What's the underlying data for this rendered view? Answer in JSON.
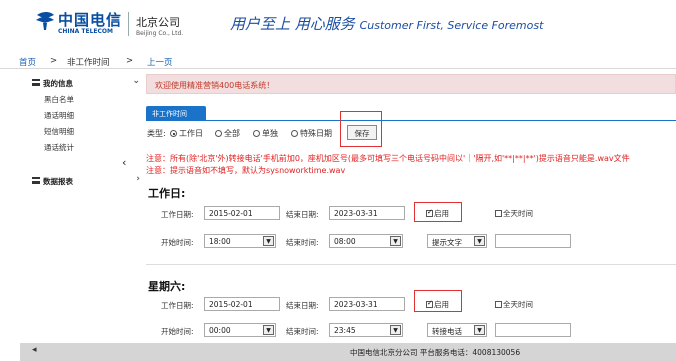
{
  "header": {
    "logo_cn": "中国电信",
    "logo_en": "CHINA TELECOM",
    "branch_cn": "北京公司",
    "branch_en": "Beijing Co., Ltd.",
    "slogan_cn": "用户至上 用心服务",
    "slogan_en": "Customer First, Service Foremost"
  },
  "breadcrumb": {
    "home": "首页",
    "sep1": ">",
    "current": "非工作时间",
    "sep2": ">",
    "prev": "上一页"
  },
  "sidebar": {
    "group1": "我的信息",
    "items": [
      "黑白名单",
      "通话明细",
      "短信明细",
      "通话统计"
    ],
    "group2": "数据报表",
    "collapse_glyph": "‹"
  },
  "notice": "欢迎使用精准营销400电话系统！",
  "tab": "非工作时间",
  "type_row": {
    "label": "类型:",
    "options": [
      "工作日",
      "全部",
      "单独",
      "特殊日期"
    ],
    "selected": "工作日",
    "save": "保存"
  },
  "warnings": {
    "line1": "注意：所有(除'北京'外)转接电话'手机前加0，座机加区号(最多可填写三个电话号码中间以'｜'隔开,如'**|**|**')提示语音只能是.wav文件",
    "line2": "注意：提示语音如不填写，默认为sysnoworktime.wav"
  },
  "workday": {
    "title": "工作日:",
    "work_date_label": "工作日期:",
    "work_date": "2015-02-01",
    "end_date_label": "结束日期:",
    "end_date": "2023-03-31",
    "enable_label": "启用",
    "enabled": true,
    "allday_label": "全天时间",
    "allday": false,
    "start_time_label": "开始时间:",
    "start_time": "18:00",
    "end_time_label": "结束时间:",
    "end_time": "08:00",
    "mode": "提示文字",
    "extra": ""
  },
  "saturday": {
    "title": "星期六:",
    "work_date_label": "工作日期:",
    "work_date": "2015-02-01",
    "end_date_label": "结束日期:",
    "end_date": "2023-03-31",
    "enable_label": "启用",
    "enabled": true,
    "allday_label": "全天时间",
    "allday": false,
    "start_time_label": "开始时间:",
    "start_time": "00:00",
    "end_time_label": "结束时间:",
    "end_time": "23:45",
    "mode": "转接电话",
    "extra": ""
  },
  "footer": {
    "text": "中国电信北京分公司 平台服务电话：4008130056"
  },
  "colors": {
    "brand_blue": "#0a4ea2",
    "tab_blue": "#1a73c9",
    "warn_red": "#e02020",
    "highlight_red": "#e03030",
    "notice_bg": "#f2dede"
  }
}
